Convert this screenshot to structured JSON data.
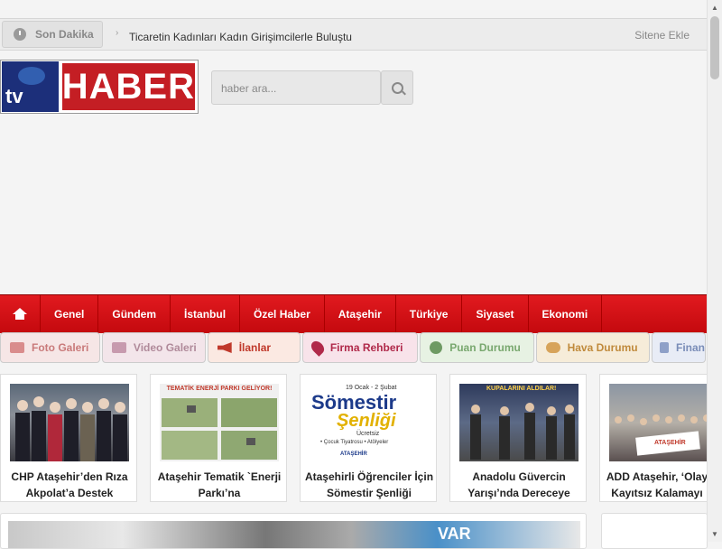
{
  "topbar": {
    "breaking_label": "Son Dakika",
    "ticker_text": "Ticaretin Kadınları Kadın Girişimcilerle Buluştu",
    "add_site_label": "Sitene Ekle"
  },
  "logo": {
    "brand_left": "tv",
    "brand_right": "HABER"
  },
  "search": {
    "placeholder": "haber ara..."
  },
  "nav": {
    "items": [
      "Genel",
      "Gündem",
      "İstanbul",
      "Özel Haber",
      "Ataşehir",
      "Türkiye",
      "Siyaset",
      "Ekonomi"
    ]
  },
  "subnav": {
    "items": [
      {
        "label": "Foto Galeri",
        "icon": "camera-icon",
        "color": "#c97a7a",
        "bg": "#f6e6e6"
      },
      {
        "label": "Video Galeri",
        "icon": "video-camera-icon",
        "color": "#b08a9a",
        "bg": "#f3e5ea"
      },
      {
        "label": "İlanlar",
        "icon": "megaphone-icon",
        "color": "#c0392b",
        "bg": "#fbe9e2"
      },
      {
        "label": "Firma Rehberi",
        "icon": "location-pin-icon",
        "color": "#b0294a",
        "bg": "#f8e3ea"
      },
      {
        "label": "Puan Durumu",
        "icon": "soccer-ball-icon",
        "color": "#79a86f",
        "bg": "#e7f2e3"
      },
      {
        "label": "Hava Durumu",
        "icon": "weather-icon",
        "color": "#c08a3c",
        "bg": "#f6ecd9"
      },
      {
        "label": "Finan",
        "icon": "money-icon",
        "color": "#7a8db8",
        "bg": "#e8ecf6"
      }
    ]
  },
  "cards": [
    {
      "caption": "CHP Ataşehir’den Rıza Akpolat’a Destek"
    },
    {
      "caption": "Ataşehir Tematik `Enerji Parkı’na",
      "img_text": "TEMATİK ENERJİ PARKI GELİYOR!"
    },
    {
      "caption": "Ataşehirli Öğrenciler İçin Sömestir Şenliği",
      "img_text": "Sömestir",
      "img_text2": "Şenliği",
      "img_text3": "Ücretsiz",
      "img_text4": "19 Ocak - 2 Şubat",
      "img_text5": "• Çocuk Tiyatrosu   • Atölyeler",
      "img_text6": "ATAŞEHİR"
    },
    {
      "caption": "Anadolu Güvercin Yarışı’nda Dereceye",
      "img_text": "KUPALARINI ALDILAR!"
    },
    {
      "caption": "ADD Ataşehir, ‘Olay Kayıtsız Kalamayı",
      "img_text": "ATAŞEHİR"
    }
  ],
  "bottom": {
    "img_text": "VAR"
  }
}
